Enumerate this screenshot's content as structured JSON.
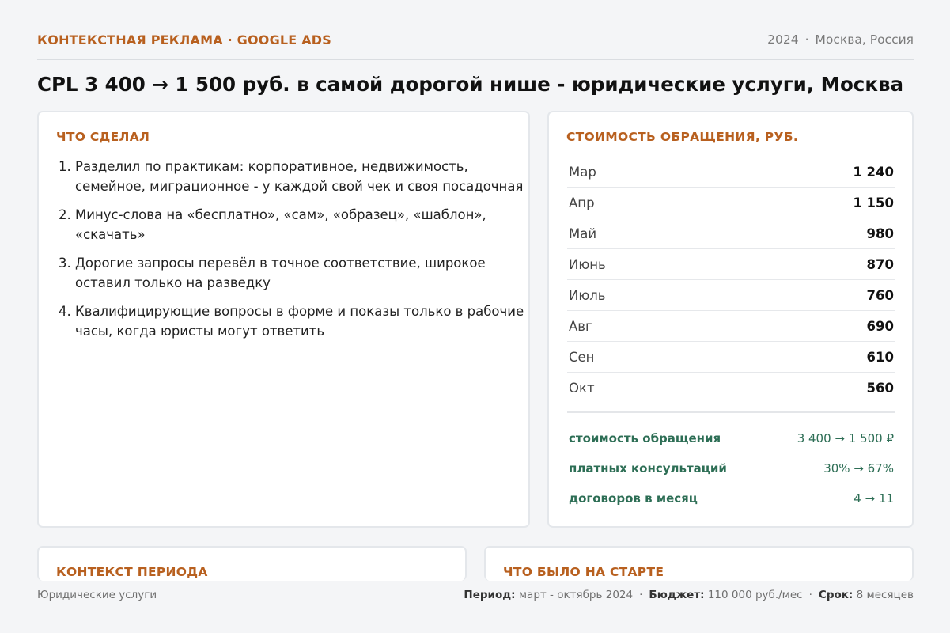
{
  "header": {
    "eyebrow": "КОНТЕКСТНАЯ РЕКЛАМА · GOOGLE ADS",
    "year": "2024",
    "separator": "·",
    "location": "Москва, Россия"
  },
  "title": "CPL 3 400 → 1 500 руб. в самой дорогой нише - юридические услуги, Москва",
  "actions": {
    "title": "ЧТО СДЕЛАЛ",
    "items": [
      "Разделил по практикам: корпоративное, недвижимость, семейное, миграционное - у каждой свой чек и своя посадочная",
      "Минус-слова на «бесплатно», «сам», «образец», «шаблон», «скачать»",
      "Дорогие запросы перевёл в точное соответствие, широкое оставил только на разведку",
      "Квалифицирующие вопросы в форме и показы только в рабочие часы, когда юристы могут ответить"
    ]
  },
  "cost": {
    "title": "СТОИМОСТЬ ОБРАЩЕНИЯ, РУБ.",
    "rows": [
      {
        "month": "Мар",
        "value": "1 240"
      },
      {
        "month": "Апр",
        "value": "1 150"
      },
      {
        "month": "Май",
        "value": "980"
      },
      {
        "month": "Июнь",
        "value": "870"
      },
      {
        "month": "Июль",
        "value": "760"
      },
      {
        "month": "Авг",
        "value": "690"
      },
      {
        "month": "Сен",
        "value": "610"
      },
      {
        "month": "Окт",
        "value": "560"
      }
    ],
    "summary": [
      {
        "label": "стоимость обращения",
        "value": "3 400 → 1 500 ₽"
      },
      {
        "label": "платных консультаций",
        "value": "30% → 67%"
      },
      {
        "label": "договоров в месяц",
        "value": "4 → 11"
      }
    ]
  },
  "context": {
    "title": "КОНТЕКСТ ПЕРИОДА"
  },
  "start": {
    "title": "ЧТО БЫЛО НА СТАРТЕ"
  },
  "footer": {
    "niche": "Юридические услуги",
    "period_label": "Период:",
    "period_value": "март - октябрь 2024",
    "budget_label": "Бюджет:",
    "budget_value": "110 000 руб./мес",
    "term_label": "Срок:",
    "term_value": "8 месяцев",
    "separator": "·"
  },
  "colors": {
    "accent": "#b8601f",
    "positive": "#2d6e55",
    "background": "#f4f5f7"
  }
}
